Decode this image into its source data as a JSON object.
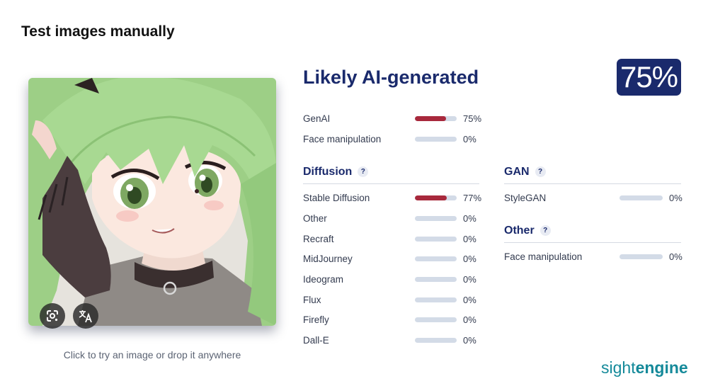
{
  "page": {
    "title": "Test images manually"
  },
  "upload": {
    "hint": "Click to try an image or drop it anywhere"
  },
  "result": {
    "verdict": "Likely AI-generated",
    "score": "75%"
  },
  "summary": [
    {
      "label": "GenAI",
      "value": 0.75,
      "pct": "75%"
    },
    {
      "label": "Face manipulation",
      "value": 0,
      "pct": "0%"
    }
  ],
  "diffusion": {
    "title": "Diffusion",
    "help": "?",
    "items": [
      {
        "label": "Stable Diffusion",
        "value": 0.77,
        "pct": "77%"
      },
      {
        "label": "Other",
        "value": 0,
        "pct": "0%"
      },
      {
        "label": "Recraft",
        "value": 0,
        "pct": "0%"
      },
      {
        "label": "MidJourney",
        "value": 0,
        "pct": "0%"
      },
      {
        "label": "Ideogram",
        "value": 0,
        "pct": "0%"
      },
      {
        "label": "Flux",
        "value": 0,
        "pct": "0%"
      },
      {
        "label": "Firefly",
        "value": 0,
        "pct": "0%"
      },
      {
        "label": "Dall-E",
        "value": 0,
        "pct": "0%"
      }
    ]
  },
  "gan": {
    "title": "GAN",
    "help": "?",
    "items": [
      {
        "label": "StyleGAN",
        "value": 0,
        "pct": "0%"
      }
    ]
  },
  "other": {
    "title": "Other",
    "help": "?",
    "items": [
      {
        "label": "Face manipulation",
        "value": 0,
        "pct": "0%"
      }
    ]
  },
  "brand": {
    "part1": "sight",
    "part2": "engine"
  },
  "colors": {
    "accent": "#1a2a6c",
    "bar_fill": "#a8293c",
    "bar_track": "#d3dbe7",
    "brand": "#158a9a"
  },
  "icons": {
    "lens": "google-lens-icon",
    "translate": "translate-icon"
  }
}
